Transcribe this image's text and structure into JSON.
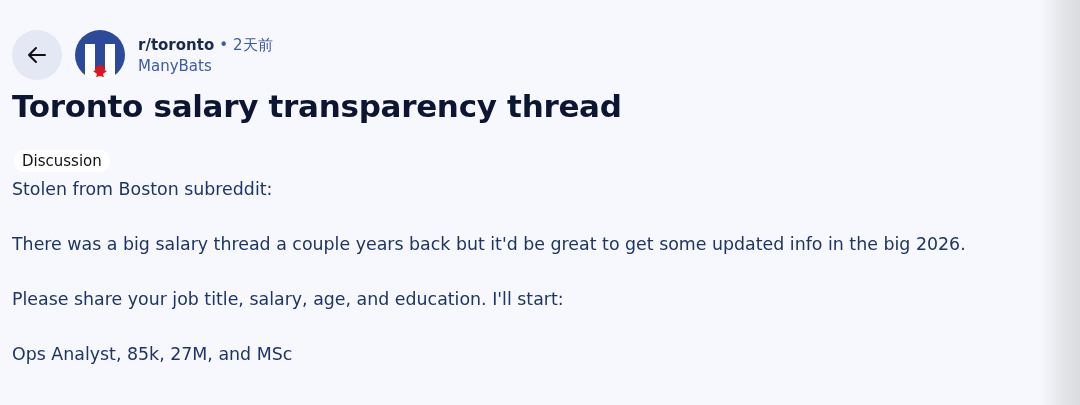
{
  "post": {
    "subreddit": "r/toronto",
    "separator": "•",
    "time": "2天前",
    "author": "ManyBats",
    "title": "Toronto salary transparency thread",
    "flair": "Discussion",
    "body": [
      "Stolen from Boston subreddit:",
      "There was a big salary thread a couple years back but it'd be great to get some updated info in the big 2026.",
      "Please share your job title, salary, age, and education. I'll start:",
      "Ops Analyst, 85k, 27M, and MSc"
    ]
  }
}
